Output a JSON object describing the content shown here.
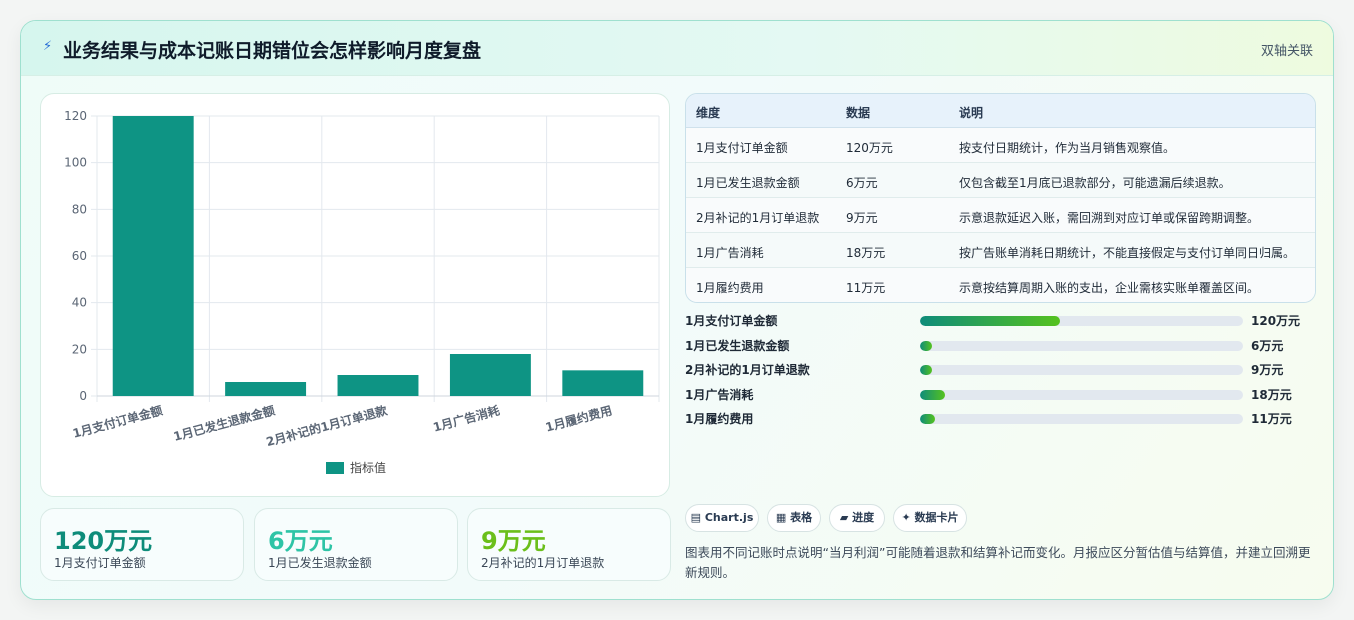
{
  "header": {
    "icon": "lightning-icon",
    "title": "业务结果与成本记账日期错位会怎样影响月度复盘",
    "badge": "双轴关联"
  },
  "chart_data": {
    "type": "bar",
    "categories": [
      "1月支付订单金额",
      "1月已发生退款金额",
      "2月补记的1月订单退款",
      "1月广告消耗",
      "1月履约费用"
    ],
    "series": [
      {
        "name": "指标值",
        "values": [
          120,
          6,
          9,
          18,
          11
        ],
        "color": "#0e9484"
      }
    ],
    "ylim": [
      0,
      120
    ],
    "yticks": [
      0,
      20,
      40,
      60,
      80,
      100,
      120
    ],
    "grid": true,
    "legend": "bottom"
  },
  "kpis": [
    {
      "value": "120万元",
      "label": "1月支付订单金额",
      "color": "#0e8c7a"
    },
    {
      "value": "6万元",
      "label": "1月已发生退款金额",
      "color": "#2ec4a6"
    },
    {
      "value": "9万元",
      "label": "2月补记的1月订单退款",
      "color": "#6bbf1a"
    }
  ],
  "table": {
    "headers": [
      "维度",
      "数据",
      "说明"
    ],
    "rows": [
      [
        "1月支付订单金额",
        "120万元",
        "按支付日期统计，作为当月销售观察值。"
      ],
      [
        "1月已发生退款金额",
        "6万元",
        "仅包含截至1月底已退款部分，可能遗漏后续退款。"
      ],
      [
        "2月补记的1月订单退款",
        "9万元",
        "示意退款延迟入账，需回溯到对应订单或保留跨期调整。"
      ],
      [
        "1月广告消耗",
        "18万元",
        "按广告账单消耗日期统计，不能直接假定与支付订单同日归属。"
      ],
      [
        "1月履约费用",
        "11万元",
        "示意按结算周期入账的支出，企业需核实账单覆盖区间。"
      ]
    ]
  },
  "progress": [
    {
      "label": "1月支付订单金额",
      "value": "120万元",
      "fraction": 0.4333
    },
    {
      "label": "1月已发生退款金额",
      "value": "6万元",
      "fraction": 0.033
    },
    {
      "label": "2月补记的1月订单退款",
      "value": "9万元",
      "fraction": 0.033
    },
    {
      "label": "1月广告消耗",
      "value": "18万元",
      "fraction": 0.077
    },
    {
      "label": "1月履约费用",
      "value": "11万元",
      "fraction": 0.046
    }
  ],
  "tags": [
    {
      "icon": "chart-icon",
      "glyph": "▤",
      "label": "Chart.js"
    },
    {
      "icon": "table-icon",
      "glyph": "▦",
      "label": "表格"
    },
    {
      "icon": "progress-icon",
      "glyph": "▰",
      "label": "进度"
    },
    {
      "icon": "sparkle-icon",
      "glyph": "✦",
      "label": "数据卡片"
    }
  ],
  "note": "图表用不同记账时点说明“当月利润”可能随着退款和结算补记而变化。月报应区分暂估值与结算值，并建立回溯更新规则。"
}
